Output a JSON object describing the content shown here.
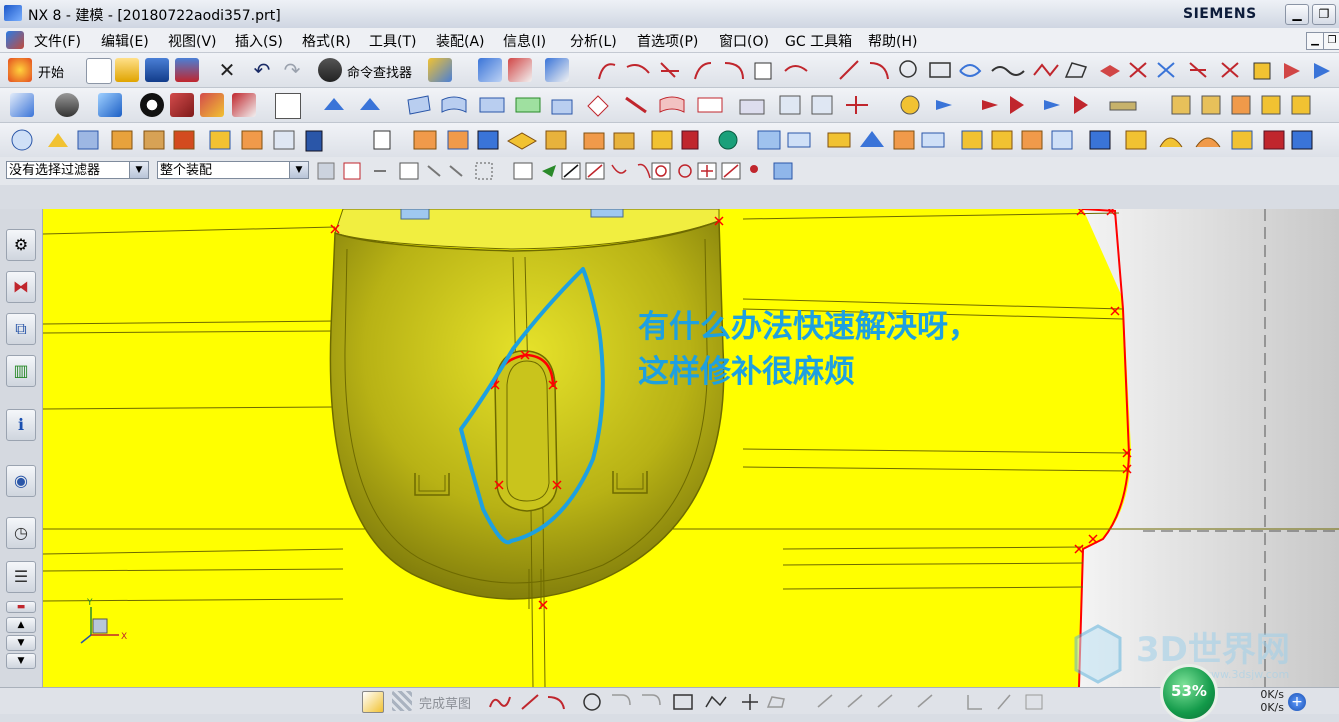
{
  "window": {
    "title": "NX 8 - 建模 - [20180722aodi357.prt]",
    "brand": "SIEMENS"
  },
  "menu": [
    "文件(F)",
    "编辑(E)",
    "视图(V)",
    "插入(S)",
    "格式(R)",
    "工具(T)",
    "装配(A)",
    "信息(I)",
    "分析(L)",
    "首选项(P)",
    "窗口(O)",
    "GC 工具箱",
    "帮助(H)"
  ],
  "toolbar": {
    "start_label": "开始",
    "finder_label": "命令查找器"
  },
  "filter": {
    "selection_filter": "没有选择过滤器",
    "scope": "整个装配"
  },
  "annotation": {
    "line1": "有什么办法快速解决呀，",
    "line2": "这样修补很麻烦",
    "color": "#1ea0e0"
  },
  "viewport": {
    "background": "#ffff00",
    "edge_color": "#ff0000"
  },
  "statusbar": {
    "finish_sketch": "完成草图",
    "gauge_percent": "53%",
    "upload": "0K/s",
    "download": "0K/s"
  },
  "watermark": {
    "text": "3D世界网",
    "url": "www.3dsjw.com"
  }
}
